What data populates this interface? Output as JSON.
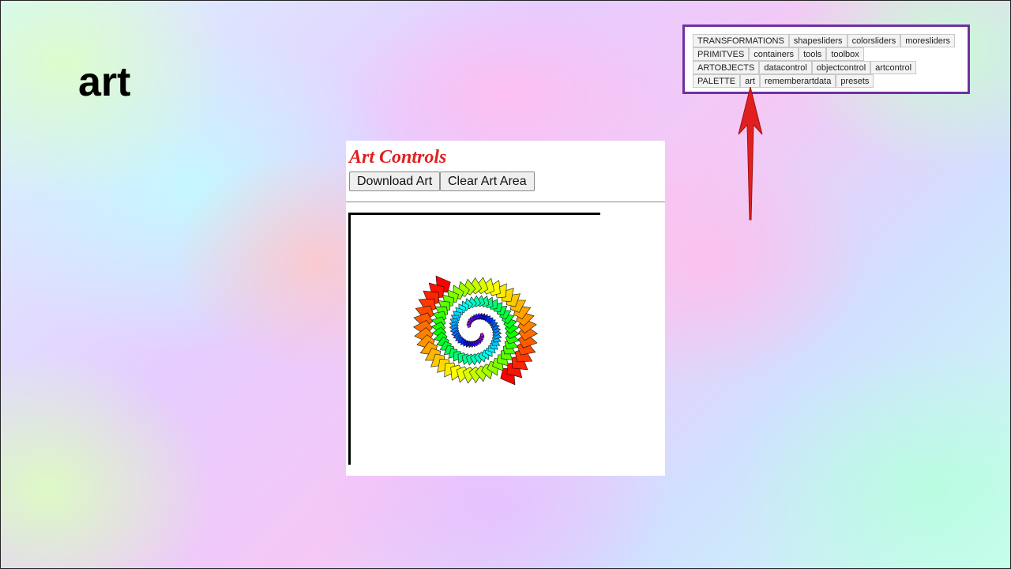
{
  "page": {
    "heading": "art"
  },
  "nav": {
    "rows": [
      [
        "TRANSFORMATIONS",
        "shapesliders",
        "colorsliders",
        "moresliders"
      ],
      [
        "PRIMITVES",
        "containers",
        "tools",
        "toolbox"
      ],
      [
        "ARTOBJECTS",
        "datacontrol",
        "objectcontrol",
        "artcontrol"
      ],
      [
        "PALETTE",
        "art",
        "rememberartdata",
        "presets"
      ]
    ],
    "border_color": "#7030a0",
    "highlighted_item": "art"
  },
  "arrow": {
    "color": "#e02020",
    "icon": "red-arrow-up-icon"
  },
  "controls": {
    "title": "Art Controls",
    "title_color": "#e02020",
    "download_label": "Download Art",
    "clear_label": "Clear Art Area"
  },
  "art": {
    "description_icon": "rainbow-spiral-artwork",
    "colors": [
      "#ff0000",
      "#ff7f00",
      "#ffff00",
      "#00ff00",
      "#00ffff",
      "#0000ff",
      "#8b00ff",
      "#ff00ff"
    ]
  }
}
